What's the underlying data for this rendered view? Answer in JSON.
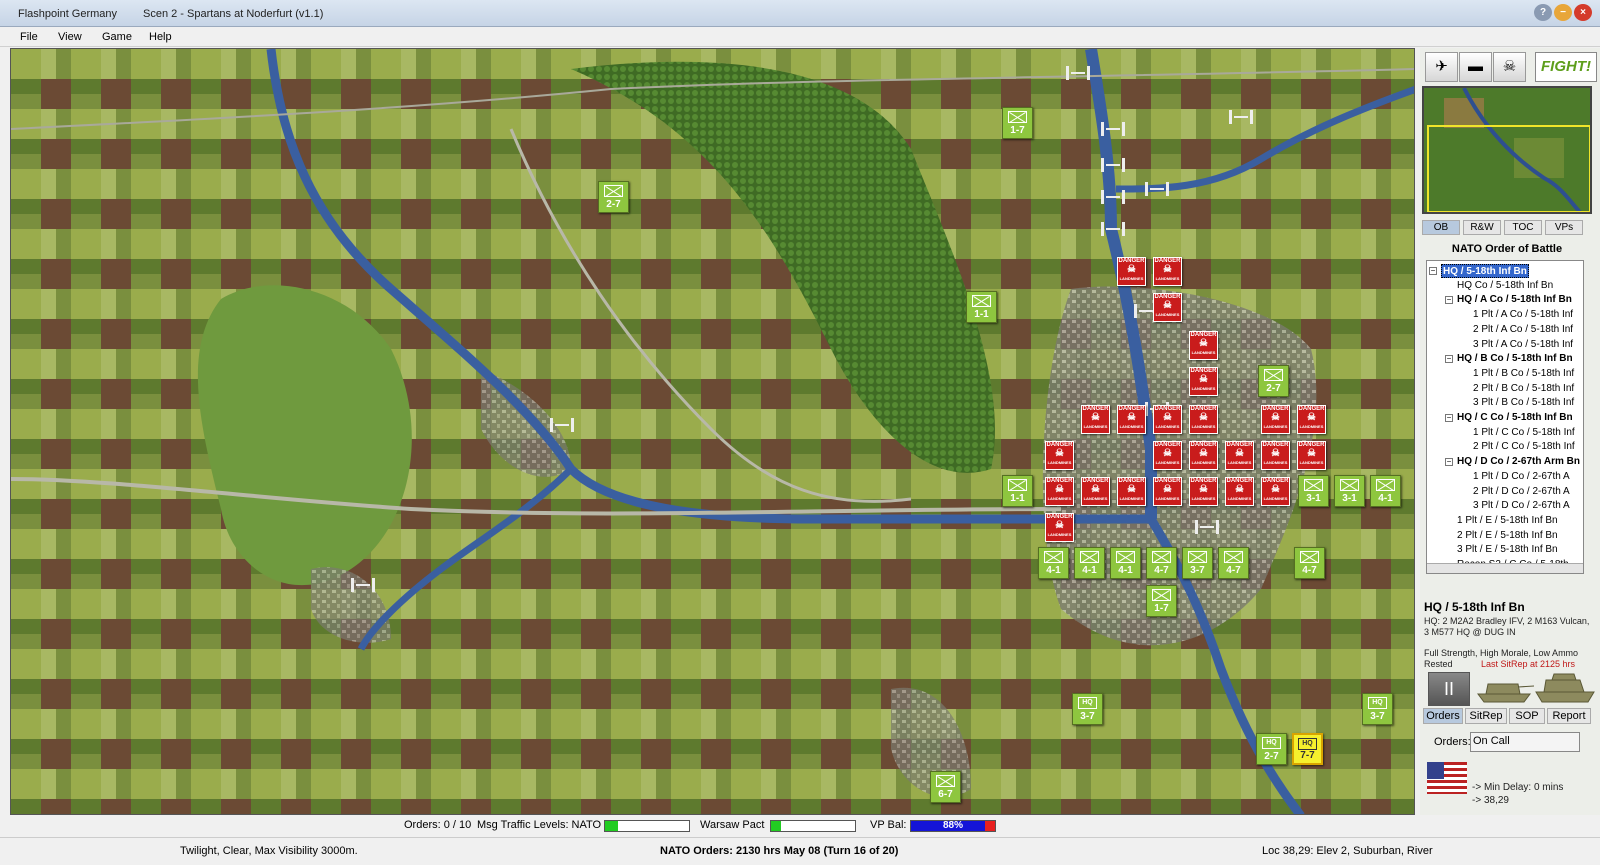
{
  "window": {
    "app_title": "Flashpoint Germany",
    "scenario_title": "Scen 2 - Spartans at Noderfurt (v1.1)"
  },
  "menu": [
    "File",
    "View",
    "Game",
    "Help"
  ],
  "side_panel": {
    "fight_label": "FIGHT!",
    "tool_icons": [
      "aircraft-icon",
      "tank-icon",
      "tank-destroyed-icon"
    ],
    "tabs": [
      "OB",
      "R&W",
      "TOC",
      "VPs"
    ],
    "ob_title": "NATO Order of Battle",
    "tree": [
      {
        "label": "HQ / 5-18th Inf Bn",
        "level": 0,
        "bold": true,
        "selected": true,
        "expand": "−"
      },
      {
        "label": "HQ Co / 5-18th Inf Bn",
        "level": 1,
        "bold": false
      },
      {
        "label": "HQ / A Co / 5-18th Inf Bn",
        "level": 1,
        "bold": true,
        "expand": "−"
      },
      {
        "label": "1 Plt / A Co / 5-18th Inf",
        "level": 2,
        "bold": false
      },
      {
        "label": "2 Plt / A Co / 5-18th Inf",
        "level": 2,
        "bold": false
      },
      {
        "label": "3 Plt / A Co / 5-18th Inf",
        "level": 2,
        "bold": false
      },
      {
        "label": "HQ / B Co / 5-18th Inf Bn",
        "level": 1,
        "bold": true,
        "expand": "−"
      },
      {
        "label": "1 Plt / B Co / 5-18th Inf",
        "level": 2,
        "bold": false
      },
      {
        "label": "2 Plt / B Co / 5-18th Inf",
        "level": 2,
        "bold": false
      },
      {
        "label": "3 Plt / B Co / 5-18th Inf",
        "level": 2,
        "bold": false
      },
      {
        "label": "HQ / C Co / 5-18th Inf Bn",
        "level": 1,
        "bold": true,
        "expand": "−"
      },
      {
        "label": "1 Plt / C Co / 5-18th Inf",
        "level": 2,
        "bold": false
      },
      {
        "label": "2 Plt / C Co / 5-18th Inf",
        "level": 2,
        "bold": false
      },
      {
        "label": "HQ / D Co / 2-67th Arm Bn",
        "level": 1,
        "bold": true,
        "expand": "−"
      },
      {
        "label": "1 Plt / D Co / 2-67th A",
        "level": 2,
        "bold": false
      },
      {
        "label": "2 Plt / D Co / 2-67th A",
        "level": 2,
        "bold": false
      },
      {
        "label": "3 Plt / D Co / 2-67th A",
        "level": 2,
        "bold": false
      },
      {
        "label": "1 Plt / E / 5-18th Inf Bn",
        "level": 1,
        "bold": false
      },
      {
        "label": "2 Plt / E / 5-18th Inf Bn",
        "level": 1,
        "bold": false
      },
      {
        "label": "3 Plt / E / 5-18th Inf Bn",
        "level": 1,
        "bold": false
      },
      {
        "label": "Recon S2 / C Co / 5-18th",
        "level": 1,
        "bold": false
      }
    ],
    "unit_detail": {
      "name": "HQ / 5-18th Inf Bn",
      "line1": "HQ: 2 M2A2 Bradley IFV, 2 M163 Vulcan,",
      "line2": "3 M577 HQ @ DUG IN",
      "status": "Full Strength, High Morale, Low Ammo",
      "rest": "Rested",
      "sitrep": "Last SitRep at 2125 hrs"
    },
    "pause_label": "II",
    "sub_tabs": [
      "Orders",
      "SitRep",
      "SOP",
      "Report"
    ],
    "orders_label": "Orders:",
    "orders_value": "On Call",
    "min_delay": "-> Min Delay: 0 mins",
    "coords": "-> 38,29"
  },
  "map": {
    "units": [
      {
        "label": "1-7",
        "kind": "inf"
      },
      {
        "label": "2-7",
        "kind": "inf"
      },
      {
        "label": "1-1",
        "kind": "inf"
      },
      {
        "label": "2-7",
        "kind": "inf"
      },
      {
        "label": "1-1",
        "kind": "inf"
      },
      {
        "label": "3-1",
        "kind": "inf"
      },
      {
        "label": "3-1",
        "kind": "inf"
      },
      {
        "label": "4-1",
        "kind": "inf"
      },
      {
        "label": "4-1",
        "kind": "inf"
      },
      {
        "label": "4-1",
        "kind": "inf"
      },
      {
        "label": "4-1",
        "kind": "inf"
      },
      {
        "label": "4-7",
        "kind": "inf"
      },
      {
        "label": "3-7",
        "kind": "inf"
      },
      {
        "label": "4-7",
        "kind": "inf"
      },
      {
        "label": "4-7",
        "kind": "inf"
      },
      {
        "label": "1-7",
        "kind": "inf"
      },
      {
        "label": "3-7",
        "kind": "hq"
      },
      {
        "label": "3-7",
        "kind": "hq"
      },
      {
        "label": "2-7",
        "kind": "hq"
      },
      {
        "label": "7-7",
        "kind": "hq",
        "selected": true
      },
      {
        "label": "6-7",
        "kind": "inf"
      }
    ],
    "minefield_text": "DANGER",
    "minefield_sub": "LANDMINES",
    "minefield_count": 25
  },
  "status": {
    "orders": "Orders: 0 / 10",
    "msg_traffic": "Msg Traffic Levels:  NATO",
    "nato_level": 0.15,
    "warsaw_label": "Warsaw Pact",
    "warsaw_level": 0.12,
    "vp_label": "VP Bal:",
    "vp_value": "88%",
    "vp_fraction": 0.88,
    "weather": "Twilight, Clear, Max Visibility 3000m.",
    "turn": "NATO Orders: 2130 hrs May 08 (Turn 16 of 20)",
    "location": "Loc 38,29: Elev 2, Suburban, River"
  },
  "colors": {
    "unit_green": "#8ec63f",
    "mine_red": "#c91c1c",
    "selected_yellow": "#f6f02d",
    "river": "#3a5fa0"
  }
}
